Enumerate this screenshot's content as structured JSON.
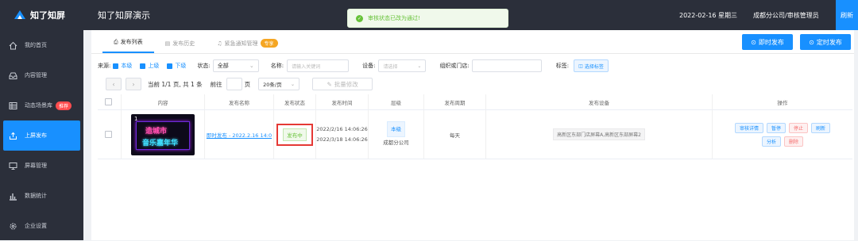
{
  "app": {
    "logo": "知了知屏",
    "title": "知了知屏演示",
    "date": "2022-02-16 星期三",
    "org_user": "成都分公司/审核管理员",
    "refresh": "刷新"
  },
  "toast": {
    "message": "审核状态已改为通过!",
    "icon": "check-circle-icon"
  },
  "sidebar": {
    "items": [
      {
        "label": "我的首页",
        "icon": "home-icon"
      },
      {
        "label": "内容管理",
        "icon": "inbox-icon"
      },
      {
        "label": "动态场景库",
        "icon": "table-icon",
        "badge": "推荐"
      },
      {
        "label": "上屏发布",
        "icon": "publish-icon",
        "active": true
      },
      {
        "label": "屏幕管理",
        "icon": "monitor-icon"
      },
      {
        "label": "数据统计",
        "icon": "bar-chart-icon"
      },
      {
        "label": "企业设置",
        "icon": "gear-icon"
      }
    ]
  },
  "tabs": [
    {
      "label": "发布列表",
      "icon": "publish-icon",
      "active": true
    },
    {
      "label": "发布历史",
      "icon": "history-icon"
    },
    {
      "label": "紧急通知管理",
      "icon": "bell-icon",
      "tag": "专享"
    }
  ],
  "actions": {
    "instant_publish": "即时发布",
    "scheduled_publish": "定时发布"
  },
  "filters": {
    "source_label": "来源:",
    "source_options": [
      "本级",
      "上级",
      "下级"
    ],
    "status_label": "状态:",
    "status_value": "全部",
    "name_label": "名称:",
    "name_placeholder": "请输入关键词",
    "device_label": "设备:",
    "device_placeholder": "请选择",
    "org_label": "组织或门店:",
    "tags_label": "标签:",
    "tags_button": "选择标签"
  },
  "pager": {
    "info": "当前 1/1 页, 共 1 条",
    "goto": "前往",
    "page_unit": "页",
    "page_size": "20条/页",
    "batch_edit": "批量修改"
  },
  "table": {
    "headers": [
      "内容",
      "发布名称",
      "发布状态",
      "发布时间",
      "层级",
      "发布周期",
      "发布设备",
      "操作"
    ],
    "rows": [
      {
        "name": "即时发布 - 2022.2.16 14:0",
        "status": "发布中",
        "time_start": "2022/2/16 14:06:26",
        "time_end": "2022/3/18 14:06:26",
        "level": "本级",
        "org": "成都分公司",
        "cycle": "每天",
        "devices": "高新区东部门店屏幕A,高新区东部屏幕2",
        "thumb_index": "1",
        "thumb_text_top": "造城市",
        "thumb_text_bottom": "音乐嘉年华",
        "ops": [
          "审核详情",
          "暂停",
          "停止",
          "刷新",
          "分析",
          "删除"
        ]
      }
    ]
  }
}
